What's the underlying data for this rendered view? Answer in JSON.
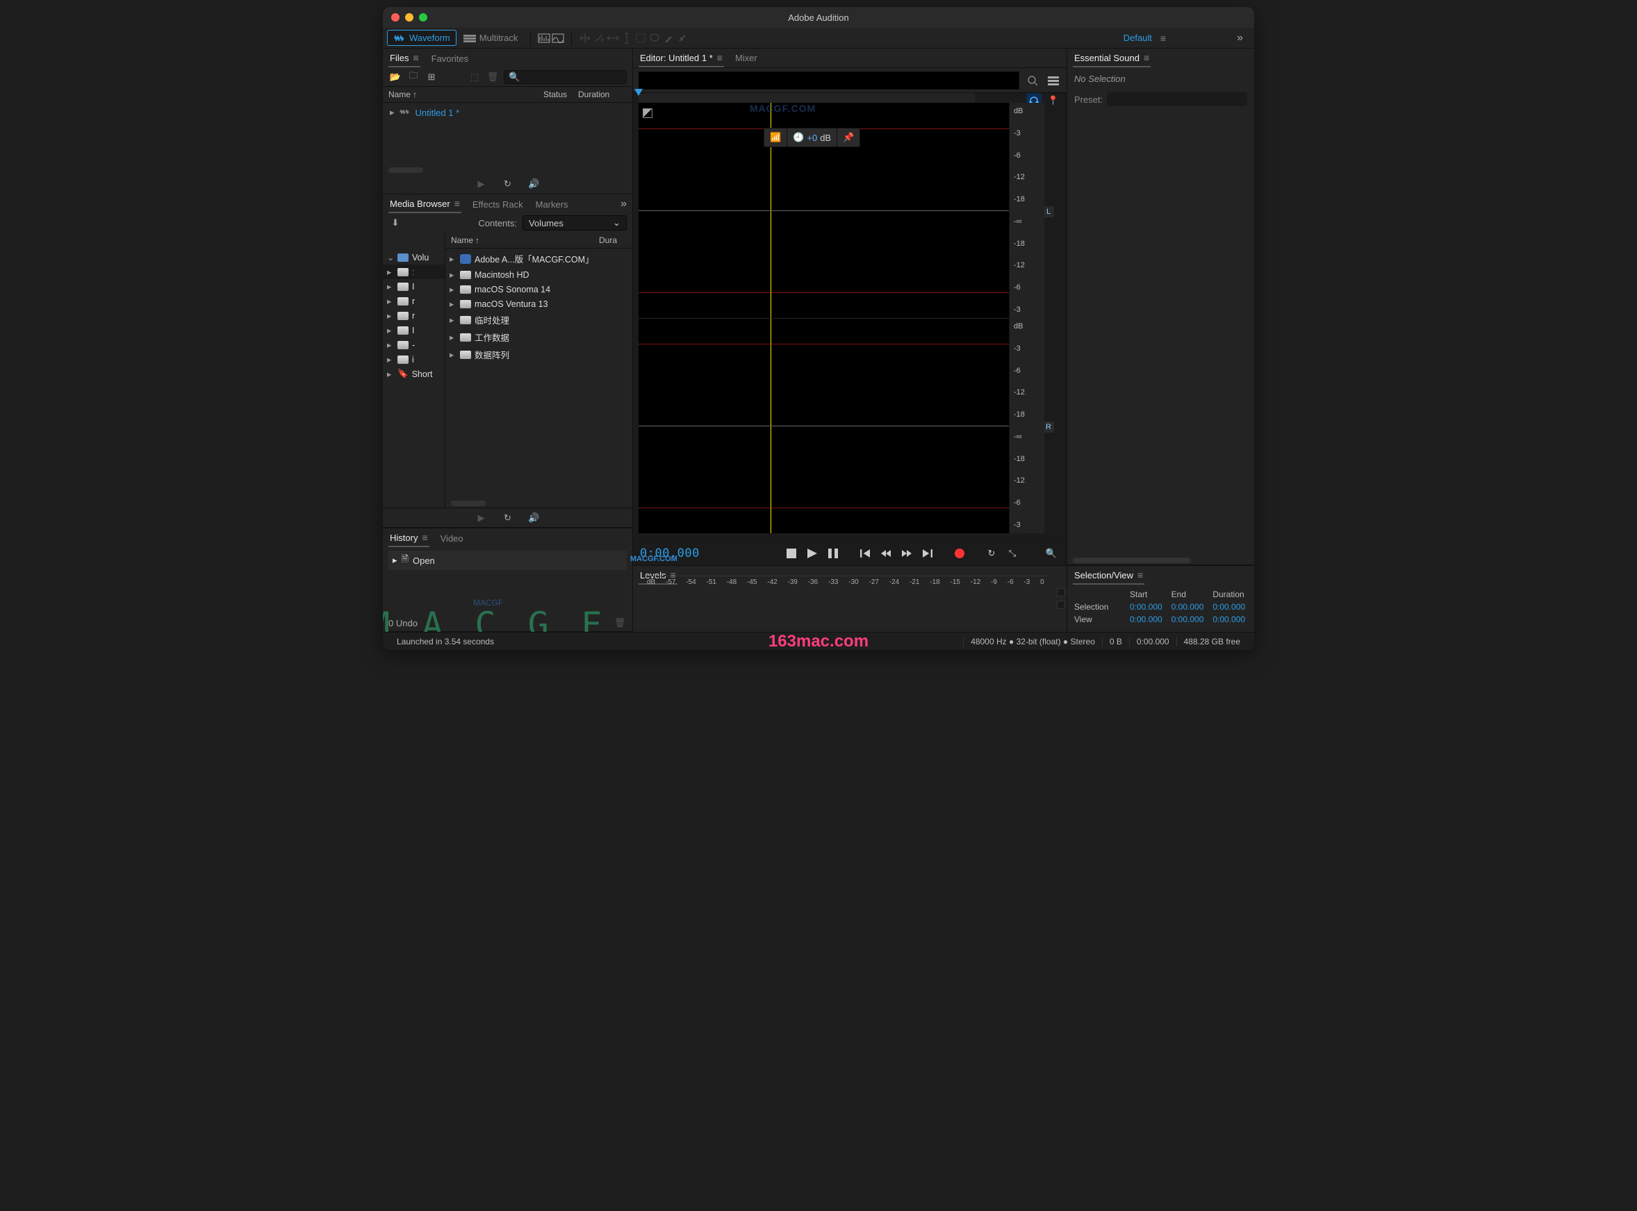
{
  "window": {
    "title": "Adobe Audition"
  },
  "toolbar": {
    "waveform": "Waveform",
    "multitrack": "Multitrack",
    "workspace_label": "Default"
  },
  "files": {
    "tab_files": "Files",
    "tab_favorites": "Favorites",
    "col_name": "Name",
    "col_status": "Status",
    "col_duration": "Duration",
    "items": [
      {
        "name": "Untitled 1 *"
      }
    ]
  },
  "media_browser": {
    "tab_mb": "Media Browser",
    "tab_er": "Effects Rack",
    "tab_markers": "Markers",
    "contents_label": "Contents:",
    "contents_value": "Volumes",
    "col_name": "Name",
    "col_dura": "Dura",
    "left": [
      {
        "name": "Volu",
        "type": "folder",
        "expanded": true
      },
      {
        "name": ":",
        "type": "drive",
        "sel": true
      },
      {
        "name": "I",
        "type": "drive"
      },
      {
        "name": "r",
        "type": "drive"
      },
      {
        "name": "r",
        "type": "drive"
      },
      {
        "name": "I",
        "type": "drive"
      },
      {
        "name": "-",
        "type": "drive"
      },
      {
        "name": "i",
        "type": "drive"
      },
      {
        "name": "Short",
        "type": "short"
      }
    ],
    "right": [
      {
        "name": "Adobe A...版「MACGF.COM」",
        "icon": "app"
      },
      {
        "name": "Macintosh HD",
        "icon": "drive"
      },
      {
        "name": "macOS Sonoma 14",
        "icon": "drive"
      },
      {
        "name": "macOS Ventura 13",
        "icon": "drive"
      },
      {
        "name": "临时处理",
        "icon": "drive"
      },
      {
        "name": "工作数据",
        "icon": "drive"
      },
      {
        "name": "数据阵列",
        "icon": "drive"
      }
    ]
  },
  "history": {
    "tab_history": "History",
    "tab_video": "Video",
    "items": [
      {
        "name": "Open"
      }
    ],
    "undo": "0 Undo"
  },
  "editor": {
    "tab_editor": "Editor: Untitled 1 *",
    "tab_mixer": "Mixer",
    "hud_value": "+0",
    "hud_unit": "dB",
    "db_ticks": [
      "dB",
      "-3",
      "-6",
      "-12",
      "-18",
      "-∞",
      "-18",
      "-12",
      "-6",
      "-3"
    ],
    "chan_l": "L",
    "chan_r": "R",
    "time": "0:00.000"
  },
  "levels": {
    "title": "Levels",
    "ruler_label": "dB",
    "ruler": [
      "-57",
      "-54",
      "-51",
      "-48",
      "-45",
      "-42",
      "-39",
      "-36",
      "-33",
      "-30",
      "-27",
      "-24",
      "-21",
      "-18",
      "-15",
      "-12",
      "-9",
      "-6",
      "-3",
      "0"
    ]
  },
  "essential_sound": {
    "title": "Essential Sound",
    "no_selection": "No Selection",
    "preset_label": "Preset:"
  },
  "selection_view": {
    "title": "Selection/View",
    "col_start": "Start",
    "col_end": "End",
    "col_duration": "Duration",
    "row_sel": "Selection",
    "row_view": "View",
    "sel": {
      "start": "0:00.000",
      "end": "0:00.000",
      "dur": "0:00.000"
    },
    "view": {
      "start": "0:00.000",
      "end": "0:00.000",
      "dur": "0:00.000"
    }
  },
  "status": {
    "launched": "Launched in 3.54 seconds",
    "format": "48000 Hz ● 32-bit (float) ● Stereo",
    "size": "0 B",
    "duration": "0:00.000",
    "free": "488.28 GB free"
  },
  "watermark": {
    "top": "MACGF.COM",
    "mid": "MACGF.COM",
    "big": "M A C G F",
    "url": "163mac.com",
    "logo": "MACGF"
  }
}
